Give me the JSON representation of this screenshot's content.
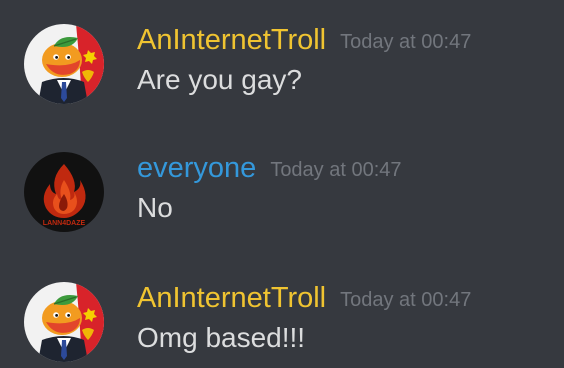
{
  "theme": {
    "background": "#36393f",
    "message_text_color": "#dcddde",
    "timestamp_color": "#72767d"
  },
  "messages": [
    {
      "author": "AnInternetTroll",
      "author_color": "#f0c431",
      "avatar_icon": "mango-man-in-suit-avatar",
      "timestamp": "Today at 00:47",
      "content": "Are you gay?"
    },
    {
      "author": "everyone",
      "author_color": "#3498db",
      "avatar_icon": "fire-logo-avatar",
      "avatar_text": "LANN4DAZE",
      "timestamp": "Today at 00:47",
      "content": "No"
    },
    {
      "author": "AnInternetTroll",
      "author_color": "#f0c431",
      "avatar_icon": "mango-man-in-suit-avatar",
      "timestamp": "Today at 00:47",
      "content": "Omg based!!!"
    }
  ]
}
